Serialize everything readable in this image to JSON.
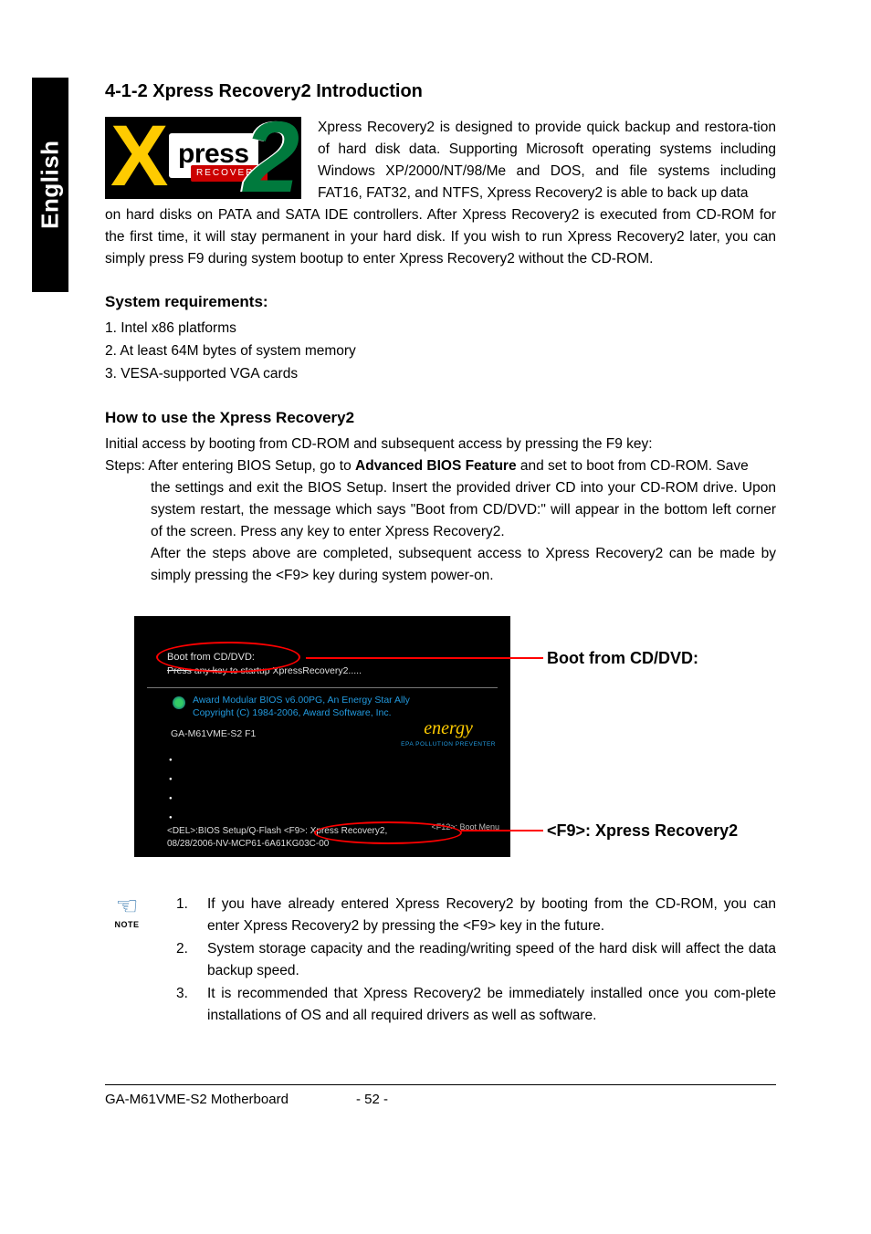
{
  "side_tab": "English",
  "heading": "4-1-2   Xpress Recovery2 Introduction",
  "logo": {
    "press": "press",
    "recovery": "RECOVERY",
    "two": "2"
  },
  "intro_top": "Xpress Recovery2 is designed to provide quick backup and restora-tion of hard disk data. Supporting Microsoft operating systems including Windows XP/2000/NT/98/Me and DOS, and file systems including FAT16, FAT32, and NTFS, Xpress Recovery2 is able to back up data",
  "intro_rest": "on hard disks on PATA and SATA IDE controllers.  After Xpress Recovery2 is executed from CD-ROM for the first time, it will stay permanent in your hard disk. If you wish to run Xpress Recovery2 later, you can simply press F9 during system bootup to enter Xpress Recovery2 without the CD-ROM.",
  "sysreq_head": "System requirements:",
  "sysreq": [
    "1. Intel x86 platforms",
    "2. At least 64M bytes of system memory",
    "3. VESA-supported VGA cards"
  ],
  "howto_head": "How to use the Xpress Recovery2",
  "howto_lead": "Initial access by booting from CD-ROM and subsequent access by pressing the F9 key:",
  "steps_prefix": "Steps: After entering BIOS Setup, go to ",
  "steps_bold": "Advanced BIOS Feature",
  "steps_suffix1": " and set to boot from CD-ROM. Save",
  "steps_body": "the settings and exit the BIOS Setup. Insert the provided driver CD into your CD-ROM drive. Upon system restart, the message which says \"Boot from CD/DVD:\" will appear in the bottom left corner of the screen.  Press any key to enter Xpress Recovery2.",
  "steps_after": "After the steps above are completed, subsequent access to Xpress Recovery2 can be made by simply pressing the <F9> key during system power-on.",
  "bios": {
    "boot": "Boot from CD/DVD:",
    "press_any_pre": "Press any k",
    "press_any_post": "ey to startup XpressRecovery2.....",
    "ally": "Award Modular BIOS v6.00PG, An Energy Star Ally\nCopyright (C) 1984-2006, Award Software, Inc.",
    "model": "GA-M61VME-S2 F1",
    "energy": "energy",
    "epa": "EPA  POLLUTION PREVENTER",
    "menu": "<DEL>:BIOS Setup/Q-Flash  <F9>: Xpress Recovery2,",
    "bootmenu_cut": "<F12>: Boot Menu",
    "date": "08/28/2006-NV-MCP61-6A61KG03C-00"
  },
  "callout1": "Boot from CD/DVD:",
  "callout2": "<F9>: Xpress Recovery2",
  "note_label": "NOTE",
  "notes": [
    {
      "n": "1.",
      "t": "If you have already entered Xpress Recovery2 by booting from the CD-ROM, you can enter Xpress Recovery2 by pressing the <F9> key in the future."
    },
    {
      "n": "2.",
      "t": "System storage capacity and the reading/writing speed of the hard disk will affect the data backup speed."
    },
    {
      "n": "3.",
      "t": "It is recommended that Xpress Recovery2 be immediately installed once you com-plete installations of OS and all required drivers as well as software."
    }
  ],
  "footer_model": "GA-M61VME-S2 Motherboard",
  "footer_page": "- 52 -"
}
